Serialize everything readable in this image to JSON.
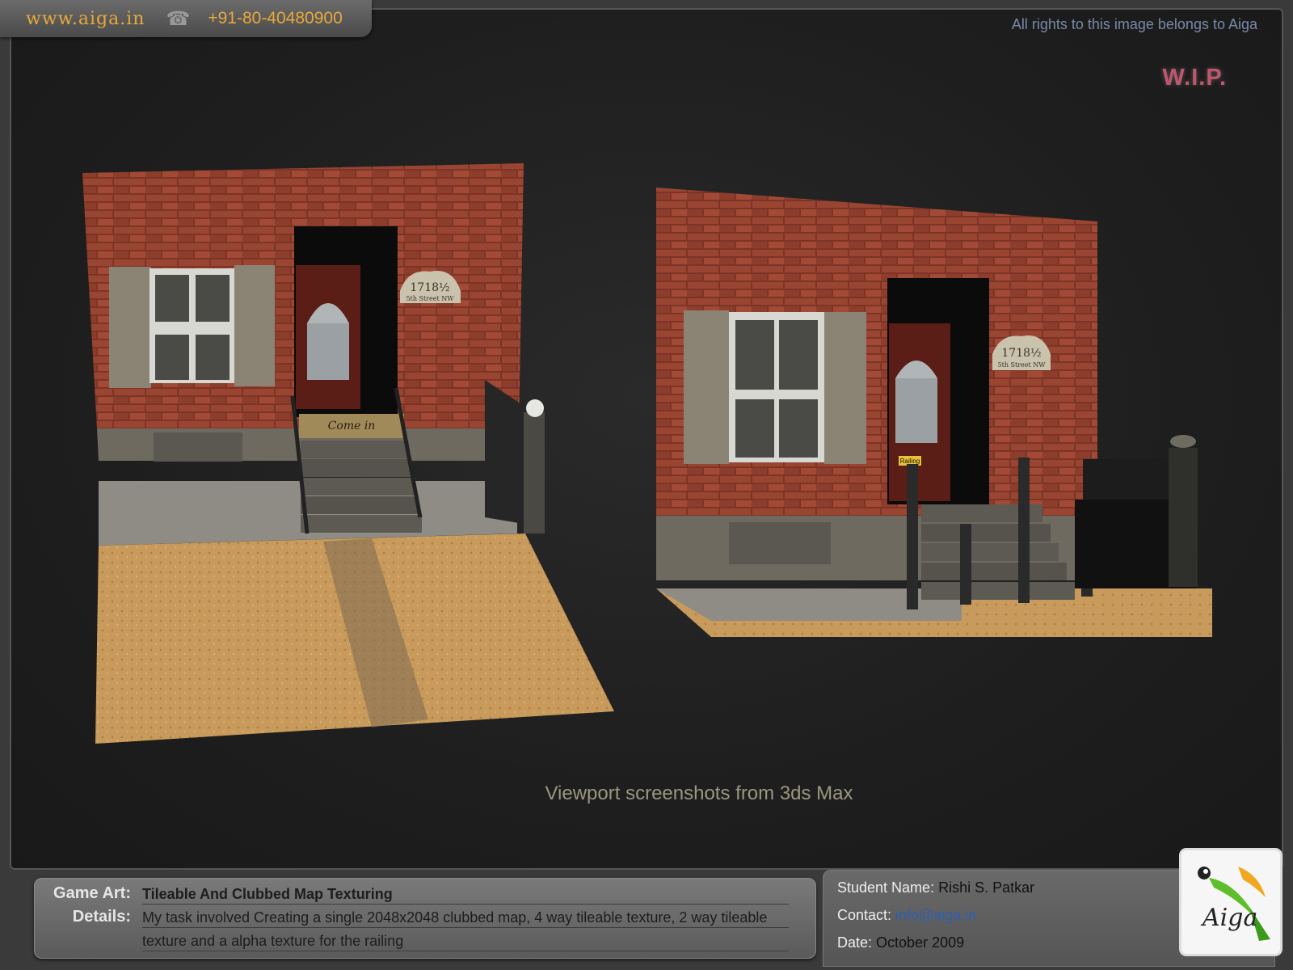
{
  "header": {
    "site": "www.aiga.in",
    "phone": "+91-80-40480900",
    "rights": "All rights to this image belongs to Aiga",
    "status": "W.I.P."
  },
  "scene": {
    "caption": "Viewport screenshots from 3ds Max",
    "house_number": "1718½",
    "street": "5th Street NW",
    "doormat_text": "Come in",
    "railing_tag": "Railing"
  },
  "info": {
    "game_art_label": "Game Art:",
    "game_art_value": "Tileable And Clubbed Map Texturing",
    "details_label": "Details:",
    "details_line1": "My task involved Creating a single 2048x2048 clubbed map,  4 way tileable texture, 2 way tileable",
    "details_line2": "texture and a alpha texture for the railing",
    "student_label": "Student Name:",
    "student_value": "Rishi S. Patkar",
    "contact_label": "Contact:",
    "contact_value": "info@aiga.in",
    "date_label": "Date:",
    "date_value": "October 2009",
    "logo_text": "Aiga"
  },
  "colors": {
    "brick": "#8a3a2a",
    "ground": "#c89a5c",
    "accent": "#e8a93a",
    "wip": "#c0566c"
  }
}
